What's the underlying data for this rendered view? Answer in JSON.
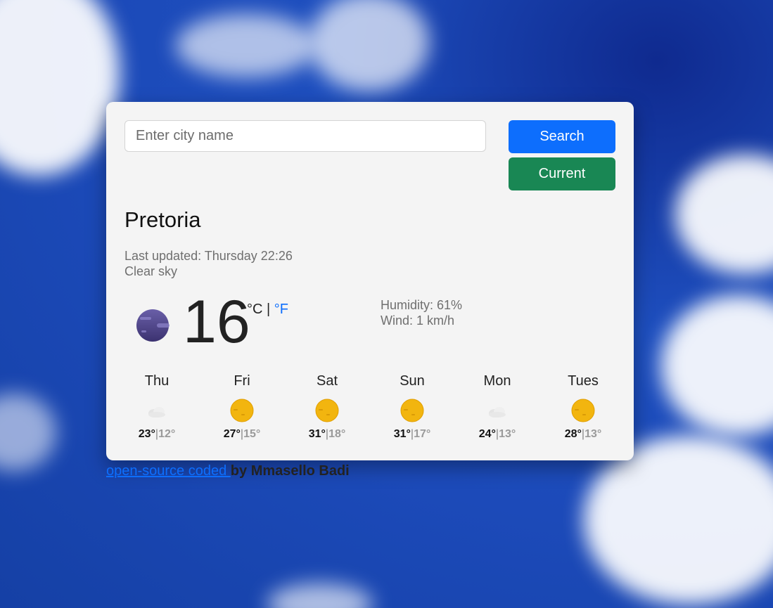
{
  "search": {
    "placeholder": "Enter city name",
    "value": ""
  },
  "buttons": {
    "search_label": "Search",
    "current_label": "Current"
  },
  "weather": {
    "city": "Pretoria",
    "last_updated": "Last updated: Thursday 22:26",
    "description": "Clear sky",
    "temperature": "16",
    "unit_c": "°C",
    "unit_sep": "|",
    "unit_f": "°F",
    "humidity": "Humidity: 61%",
    "wind": "Wind: 1 km/h",
    "icon": "moon-icon"
  },
  "forecast": [
    {
      "day": "Thu",
      "max": "23°",
      "sep": "|",
      "min": "12°",
      "icon": "cloud-icon"
    },
    {
      "day": "Fri",
      "max": "27°",
      "sep": "|",
      "min": "15°",
      "icon": "sun-icon"
    },
    {
      "day": "Sat",
      "max": "31°",
      "sep": "|",
      "min": "18°",
      "icon": "sun-icon"
    },
    {
      "day": "Sun",
      "max": "31°",
      "sep": "|",
      "min": "17°",
      "icon": "sun-icon"
    },
    {
      "day": "Mon",
      "max": "24°",
      "sep": "|",
      "min": "13°",
      "icon": "cloud-icon"
    },
    {
      "day": "Tues",
      "max": "28°",
      "sep": "|",
      "min": "13°",
      "icon": "sun-icon"
    }
  ],
  "footer": {
    "link_text": "open-source coded ",
    "by_text": "by Mmasello Badi"
  },
  "colors": {
    "search_button": "#0d6efd",
    "current_button": "#198754",
    "card_bg": "#f4f4f4",
    "link": "#0d6efd"
  }
}
